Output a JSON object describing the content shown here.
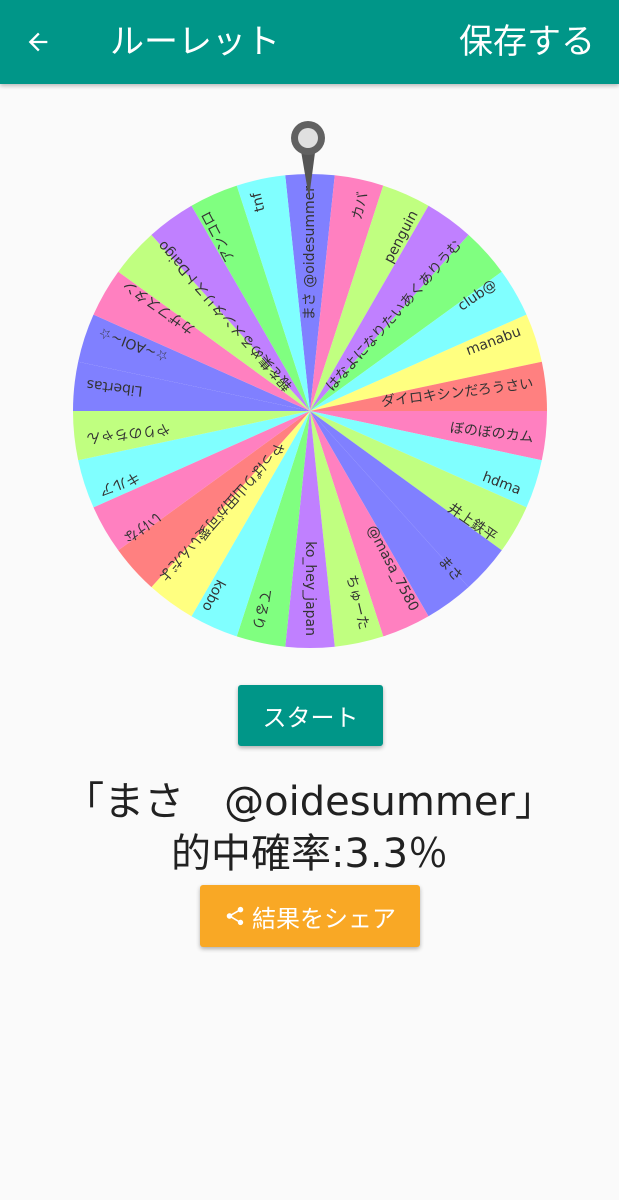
{
  "appbar": {
    "back_icon": "arrow-back-icon",
    "title": "ルーレット",
    "save_label": "保存する",
    "background": "#009688"
  },
  "wheel": {
    "pointer_icon": "map-pin-icon",
    "palette": [
      "#8080ff",
      "#ff80c0",
      "#c0ff80",
      "#c080ff",
      "#80ff80",
      "#80ffff",
      "#ffff80",
      "#ff8080",
      "#ff80c0",
      "#80ffff",
      "#c0ff80",
      "#8080ff"
    ],
    "labels": [
      "まさ @oidesummer",
      "カバ",
      "penguin",
      "はなよになりたいあくありうむ",
      "club@",
      "manabu",
      "ダイロキシンだろうさい",
      "ぼのぼのカム",
      "hdma",
      "井上鉄平",
      "まさ",
      "@masa_7580",
      "ちゅーた",
      "ko_hey_japan",
      "てるり",
      "kobo",
      "やっぱり山田が可愛いんだよ",
      "いけな",
      "キルア",
      "やりのちゃん",
      "Libertas",
      "☆~AOI~☆",
      "カザフスタン",
      "報を集めるメンタリストDaigo",
      "アンコロ",
      "tnf"
    ]
  },
  "buttons": {
    "start_label": "スタート",
    "share_label": "結果をシェア",
    "share_icon": "share-icon",
    "share_color": "#f9a825",
    "start_color": "#009688"
  },
  "result": {
    "name": "「まさ　@oidesummer」",
    "probability": "的中確率:3.3％"
  }
}
